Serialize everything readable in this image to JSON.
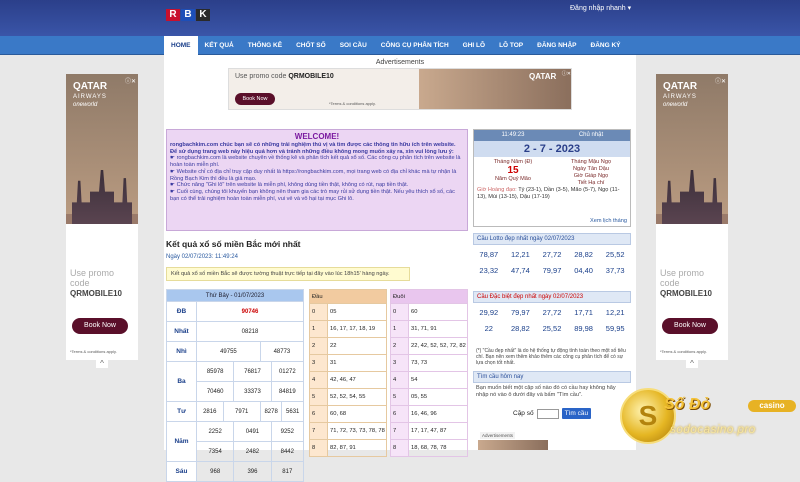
{
  "header": {
    "logo_letters": [
      "R",
      "B",
      "K"
    ],
    "login_link": "Đăng nhập nhanh ▾"
  },
  "nav": {
    "items": [
      "HOME",
      "KẾT QUẢ",
      "THỐNG KÊ",
      "CHỐT SỐ",
      "SOI CẦU",
      "CÔNG CỤ PHÂN TÍCH",
      "GHI LÔ",
      "LÔ TOP",
      "ĐĂNG NHẬP",
      "ĐĂNG KÝ"
    ],
    "active": "HOME"
  },
  "ads": {
    "label": "Advertisements",
    "brand": "QATAR",
    "brand_sub": "AIRWAYS",
    "oneworld": "oneworld",
    "promo_text": "Use promo code",
    "promo_code": "QRMOBILE10",
    "book_now": "Book Now",
    "terms": "*Terms & conditions apply.",
    "adchoices": "ⓘ✕",
    "chevron": "^"
  },
  "welcome": {
    "title": "WELCOME!",
    "intro": "rongbachkim.com chúc bạn sẽ có những trải nghiệm thú vị và tìm được các thông tin hữu ích trên website. Để sử dụng trang web này hiệu quả hơn và tránh những điều không mong muốn xảy ra, xin vui lòng lưu ý:",
    "bullets": [
      "☛ rongbachkim.com là website chuyên về thống kê và phân tích kết quả xổ số. Các công cụ phân tích trên website là hoàn toàn miễn phí.",
      "☛ Website chỉ có địa chỉ truy cập duy nhất là https://rongbachkim.com, mọi trang web có địa chỉ khác mà tự nhận là Rồng Bạch Kim thì đều là giả mạo.",
      "☛ Chức năng \"Ghi lô\" trên website là miễn phí, không dùng tiền thật, không có rút, nạp tiền thật.",
      "☛ Cuối cùng, chúng tôi khuyến bạn không nên tham gia các trò may rủi sử dụng tiền thật. Nếu yêu thích xổ số, các bạn có thể trải nghiệm hoàn toàn miễn phí, vui vẻ và vô hại tại mục Ghi lô."
    ]
  },
  "results": {
    "title": "Kết quả xổ số miền Bắc mới nhất",
    "date": "Ngày 02/07/2023: 11:49:24",
    "notice": "Kết quả xổ số miền Bắc sẽ được tường thuật trực tiếp tại đây vào lúc 18h15' hàng ngày.",
    "table_header": "Thứ Bảy - 01/07/2023",
    "rows": [
      {
        "label": "ĐB",
        "values": [
          "90746"
        ]
      },
      {
        "label": "Nhất",
        "values": [
          "08218"
        ]
      },
      {
        "label": "Nhì",
        "values": [
          "49755",
          "48773"
        ]
      },
      {
        "label": "Ba",
        "values": [
          "85978",
          "76817",
          "01272",
          "70460",
          "33373",
          "84819"
        ]
      },
      {
        "label": "Tư",
        "values": [
          "2816",
          "7971",
          "8278",
          "5631"
        ]
      },
      {
        "label": "Năm",
        "values": [
          "2252",
          "0491",
          "9252",
          "7354",
          "2482",
          "8442"
        ]
      },
      {
        "label": "Sáu",
        "values": [
          "968",
          "396",
          "817"
        ]
      }
    ],
    "dau_header": "Đầu",
    "dau": [
      {
        "h": "0",
        "v": "05"
      },
      {
        "h": "1",
        "v": "16, 17, 17, 18, 19"
      },
      {
        "h": "2",
        "v": "22"
      },
      {
        "h": "3",
        "v": "31"
      },
      {
        "h": "4",
        "v": "42, 46, 47"
      },
      {
        "h": "5",
        "v": "52, 52, 54, 55"
      },
      {
        "h": "6",
        "v": "60, 68"
      },
      {
        "h": "7",
        "v": "71, 72, 73, 73, 78, 78"
      },
      {
        "h": "8",
        "v": "82, 87, 91"
      }
    ],
    "duoi_header": "Đuôi",
    "duoi": [
      {
        "h": "0",
        "v": "60"
      },
      {
        "h": "1",
        "v": "31, 71, 91"
      },
      {
        "h": "2",
        "v": "22, 42, 52, 52, 72, 82"
      },
      {
        "h": "3",
        "v": "73, 73"
      },
      {
        "h": "4",
        "v": "54"
      },
      {
        "h": "5",
        "v": "05, 55"
      },
      {
        "h": "6",
        "v": "16, 46, 96"
      },
      {
        "h": "7",
        "v": "17, 17, 47, 87"
      },
      {
        "h": "8",
        "v": "18, 68, 78, 78"
      }
    ]
  },
  "calendar": {
    "time": "11:49:23",
    "weekday": "Chủ nhật",
    "date": "2 - 7 - 2023",
    "lunar_month": "Tháng Năm (Đ)",
    "lunar_day": "15",
    "lunar_year": "Năm Quý Mão",
    "right_lines": [
      "Tháng Mậu Ngọ",
      "Ngày Tân Dậu",
      "Giờ Giáp Ngọ",
      "Tiết Hạ chí"
    ],
    "gio_hoang_dao_label": "Giờ Hoàng đạo:",
    "gio_hoang_dao": "Tý (23-1), Dần (3-5), Mão (5-7), Ngọ (11-13), Mùi (13-15), Dậu (17-19)",
    "more": "Xem lịch tháng"
  },
  "lotto": {
    "title": "Cầu Lotto đẹp nhất ngày 02/07/2023",
    "values": [
      "78,87",
      "12,21",
      "27,72",
      "28,82",
      "25,52",
      "23,32",
      "47,74",
      "79,97",
      "04,40",
      "37,73"
    ]
  },
  "special": {
    "title": "Cầu Đặc biệt đẹp nhất ngày 02/07/2023",
    "values": [
      "29,92",
      "79,97",
      "27,72",
      "17,71",
      "12,21",
      "22",
      "28,82",
      "25,52",
      "89,98",
      "59,95"
    ],
    "note": "(*) \"Cầu đẹp nhất\" là do hệ thống tự động tính toán theo một số tiêu chí. Bạn nên xem thêm khảo thêm các công cụ phân tích để có sự lựa chọn tốt nhất."
  },
  "search": {
    "title": "Tìm cầu hôm nay",
    "desc": "Bạn muốn biết một cặp số nào đó có cầu hay không hãy nhập nó vào ô dưới đây và bấm \"Tìm cầu\".",
    "label": "Cặp số",
    "button": "Tìm cầu"
  },
  "bottom_ad": {
    "label": "Advertisements"
  },
  "casino": {
    "name": "Số Đỏ",
    "pill": "casino",
    "url": "sodocasino.pro",
    "coin": "S"
  }
}
